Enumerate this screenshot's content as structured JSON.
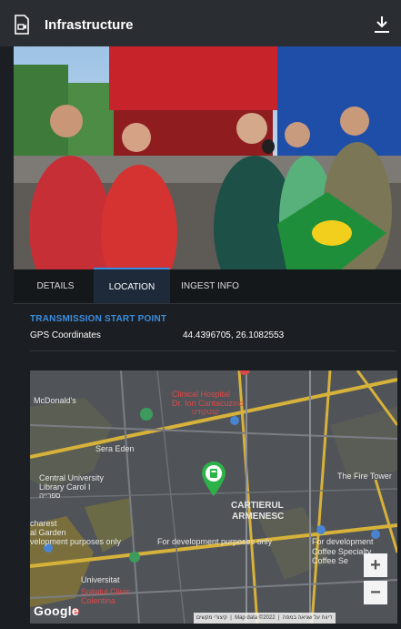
{
  "header": {
    "title": "Infrastructure",
    "icon": "camera-file-icon",
    "download_icon": "download-icon"
  },
  "tabs": [
    {
      "label": "DETAILS",
      "active": false
    },
    {
      "label": "LOCATION",
      "active": true
    },
    {
      "label": "INGEST INFO",
      "active": false
    }
  ],
  "location": {
    "section_title": "TRANSMISSION START POINT",
    "gps_label": "GPS Coordinates",
    "gps_value": "44.4396705, 26.1082553"
  },
  "map": {
    "labels": {
      "mcdonalds": "McDonald's",
      "clinical_hospital": "Clinical Hospital",
      "dr_ion": "Dr. Ion Cantacuzino",
      "hebrew_1": "קנטקוזינו",
      "sera_eden": "Sera Eden",
      "central_university_1": "Central University",
      "central_university_2": "Library Carol I",
      "hebrew_2": "ספרייה",
      "bucharest_1": "charest",
      "bucharest_2": "al Garden",
      "cartierul": "CARTIERUL",
      "armenesc": "ARMENESC",
      "fire_tower": "The Fire Tower",
      "dev_1": "velopment purposes only",
      "dev_2": "For development purposes only",
      "dev_3": "For development",
      "coffee_1": "Coffee Specialty",
      "coffee_2": "Coffee Se",
      "universitat": "Universitat",
      "spitalul": "Spitalul Clinic",
      "colentina": "Colentina"
    },
    "attribution": "Map data ©2022",
    "attribution_terms": "קיצורי מקשים",
    "attribution_report": "דיווח על שגיאה במפה",
    "google": "Google",
    "zoom_in": "+",
    "zoom_out": "−"
  },
  "colors": {
    "accent": "#3b8ee0",
    "marker": "#2db24a"
  }
}
